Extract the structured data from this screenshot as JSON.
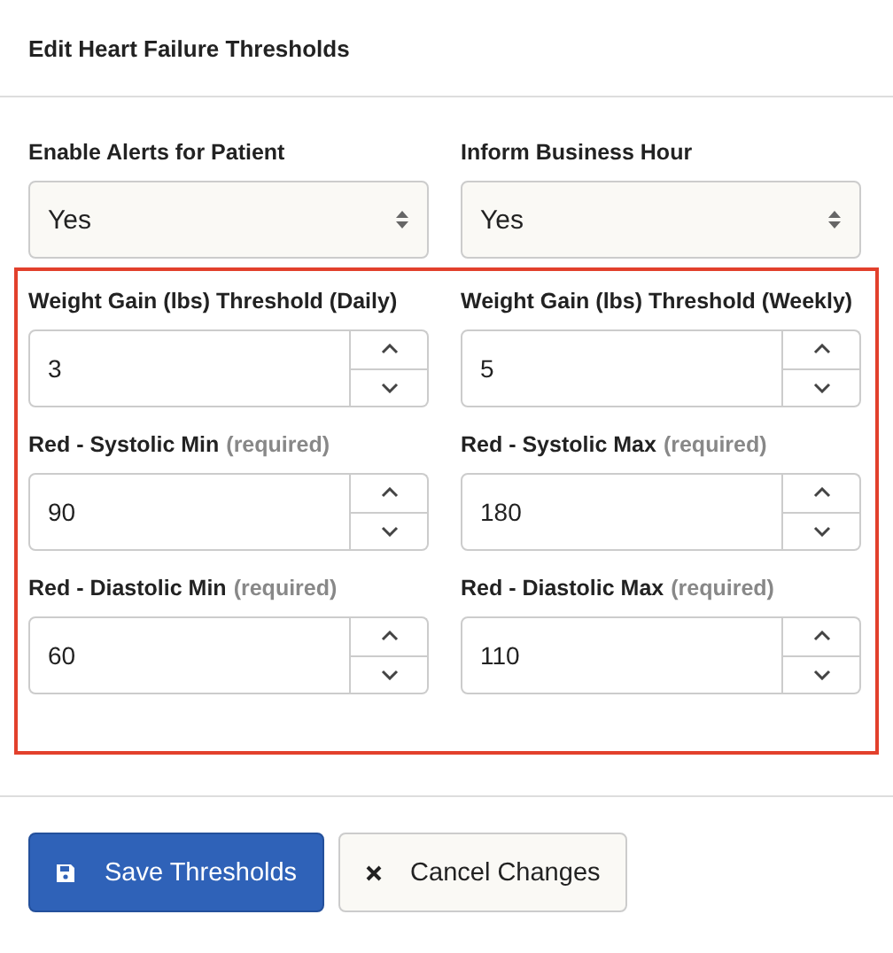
{
  "title": "Edit Heart Failure Thresholds",
  "selects": [
    {
      "label": "Enable Alerts for Patient",
      "value": "Yes"
    },
    {
      "label": "Inform Business Hour",
      "value": "Yes"
    }
  ],
  "thresholds": [
    {
      "label": "Weight Gain (lbs) Threshold (Daily)",
      "value": "3"
    },
    {
      "label": "Weight Gain (lbs) Threshold (Weekly)",
      "value": "5"
    },
    {
      "label": "Red - Systolic Min",
      "note": "(required)",
      "value": "90"
    },
    {
      "label": "Red - Systolic Max",
      "note": "(required)",
      "value": "180"
    },
    {
      "label": "Red - Diastolic Min",
      "note": "(required)",
      "value": "60"
    },
    {
      "label": "Red - Diastolic Max",
      "note": "(required)",
      "value": "110"
    }
  ],
  "buttons": [
    {
      "kind": "primary",
      "label": "Save Thresholds"
    },
    {
      "kind": "secondary",
      "label": "Cancel Changes"
    }
  ]
}
